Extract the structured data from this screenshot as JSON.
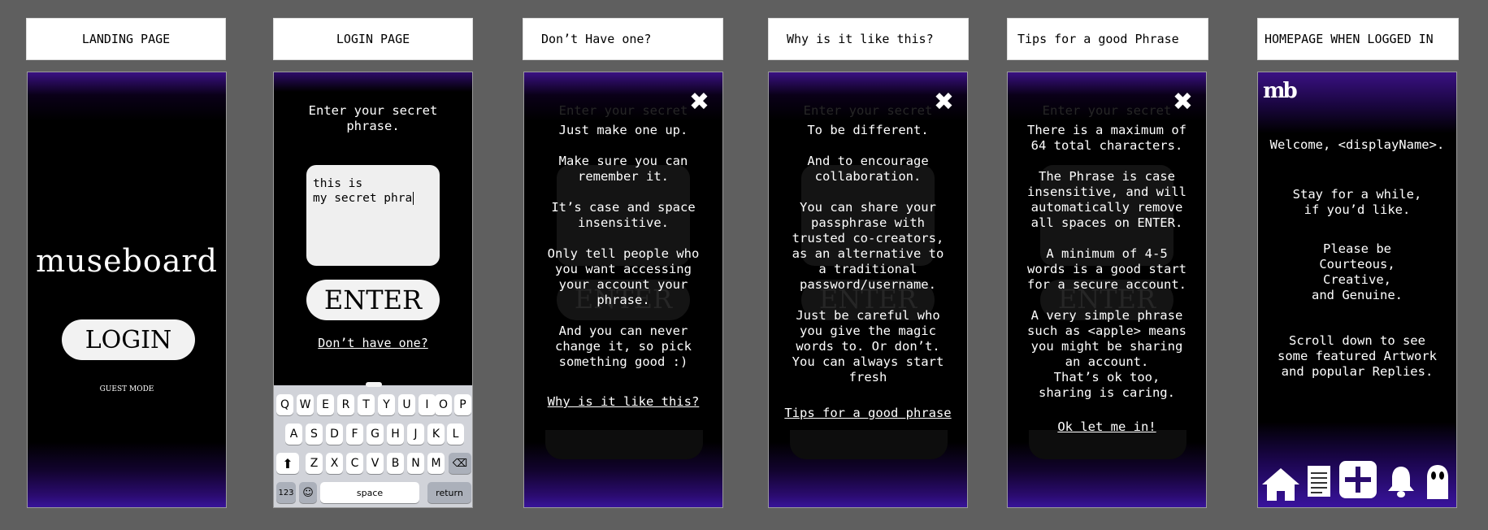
{
  "labels": [
    "LANDING PAGE",
    "LOGIN PAGE",
    "Don’t Have one?",
    "Why is it like this?",
    "Tips for a good Phrase",
    "HOMEPAGE WHEN LOGGED IN"
  ],
  "landing": {
    "brand": "museboard",
    "login": "LOGIN",
    "guest": "GUEST MODE"
  },
  "login": {
    "prompt": "Enter your secret\nphrase.",
    "input_value": "this is\nmy secret phra",
    "enter": "ENTER",
    "dont_have": "Don’t have one?",
    "keyboard": {
      "row1": [
        "Q",
        "W",
        "E",
        "R",
        "T",
        "Y",
        "U",
        "I",
        "O",
        "P"
      ],
      "row2": [
        "A",
        "S",
        "D",
        "F",
        "G",
        "H",
        "J",
        "K",
        "L"
      ],
      "row3": [
        "Z",
        "X",
        "C",
        "V",
        "B",
        "N",
        "M"
      ],
      "num": "123",
      "space": "space",
      "return": "return"
    }
  },
  "dont": {
    "ghost_prompt": "Enter your secret",
    "ghost_enter": "ENTER",
    "body": "Just make one up.\n\nMake sure you can\nremember it.\n\nIt’s case and space\ninsensitive.\n\nOnly tell people who\nyou want accessing\nyour account your\nphrase.\n\nAnd you can never\nchange it, so pick\nsomething good :)",
    "link": "Why is it like this?"
  },
  "why": {
    "ghost_prompt": "Enter your secret",
    "ghost_enter": "ENTER",
    "body": "To be different.\n\nAnd to encourage\ncollaboration.\n\nYou can share your\npassphrase with\ntrusted co-creators,\nas an alternative to\na traditional\npassword/username.\n\nJust be careful who\nyou give the magic\nwords to. Or don’t.\nYou can always start\nfresh",
    "link": "Tips for a good phrase"
  },
  "tips": {
    "ghost_prompt": "Enter your secret",
    "ghost_enter": "ENTER",
    "body": "There is a maximum of\n64 total characters.\n\nThe Phrase is case\ninsensitive, and will\nautomatically remove\nall spaces on ENTER.\n\nA minimum of 4-5\nwords is a good start\nfor a secure account.\n\nA very simple phrase\nsuch as <apple> means\nyou might be sharing\nan account.\nThat’s ok too,\nsharing is caring.",
    "link": "Ok let me in!"
  },
  "home": {
    "logo": "mb",
    "welcome": "Welcome, <displayName>.",
    "stay": "Stay for a while,\nif you’d like.",
    "please": "Please be\nCourteous,\nCreative,\nand Genuine.",
    "scroll": "Scroll down to see\nsome featured Artwork\nand popular Replies."
  }
}
